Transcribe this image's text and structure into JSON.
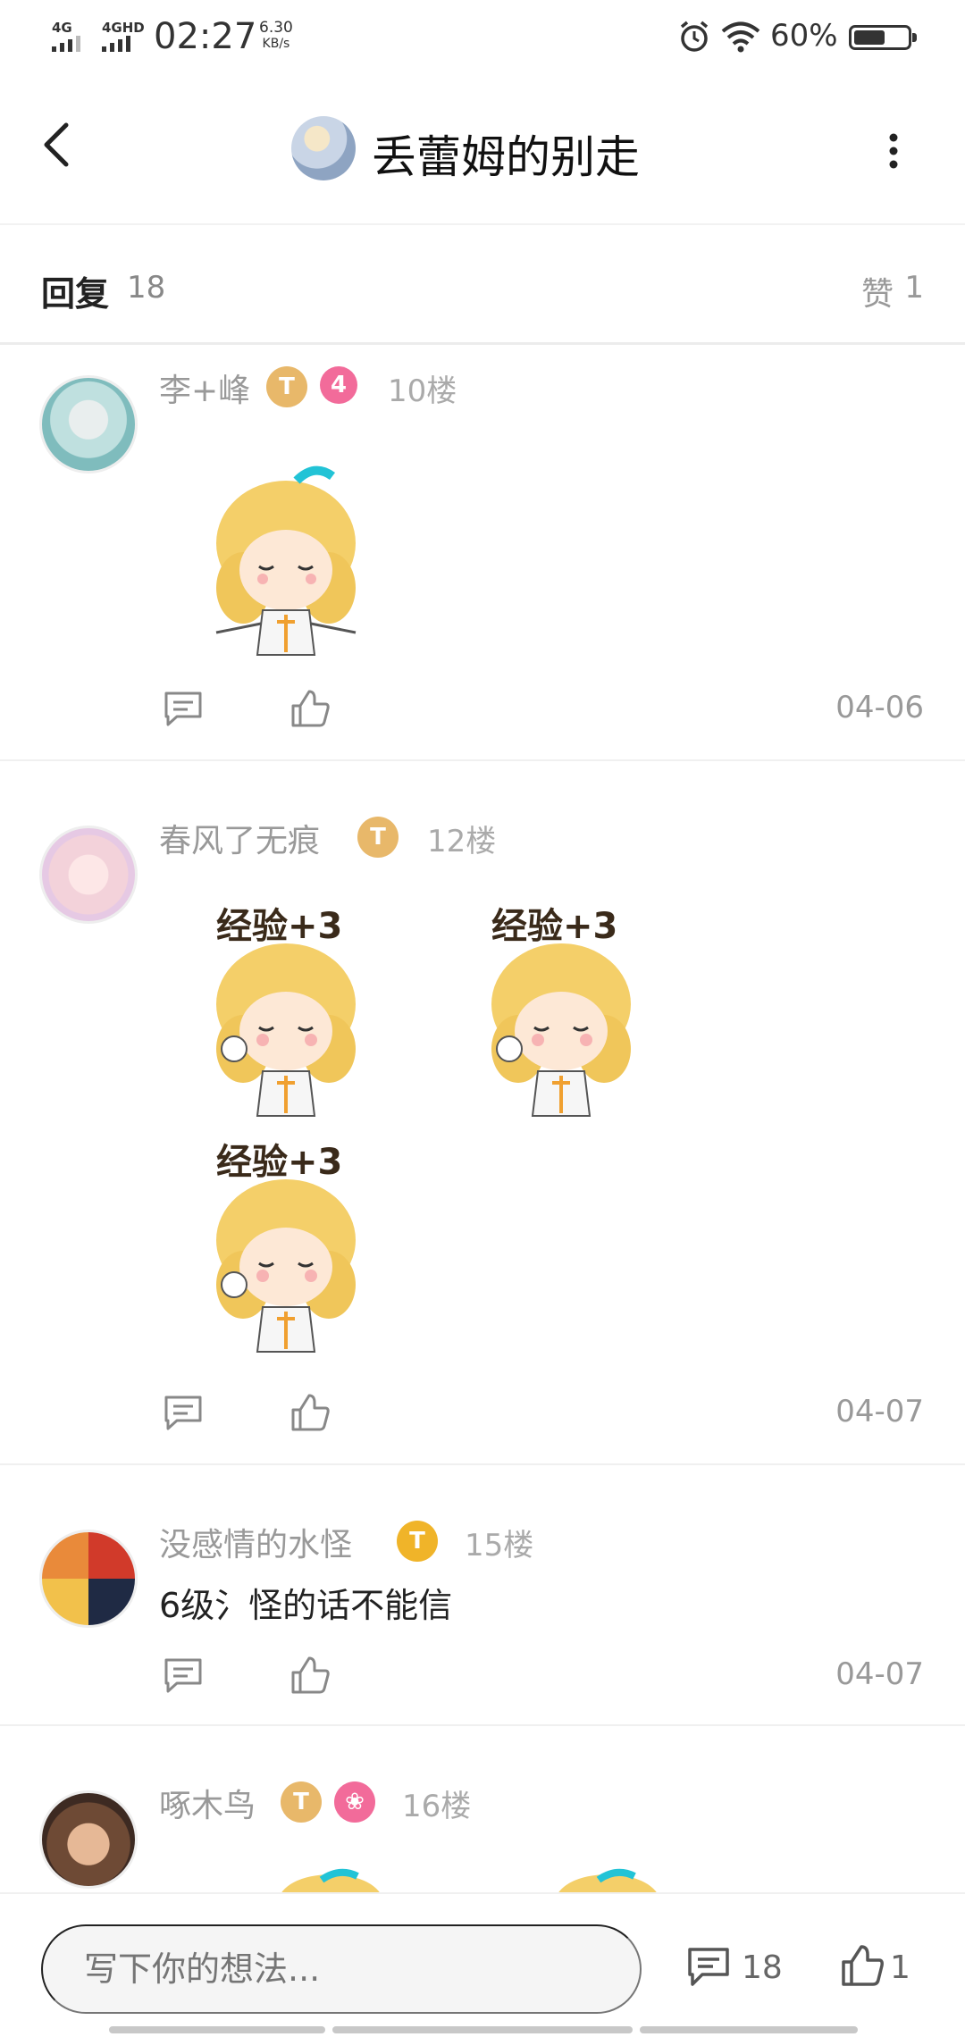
{
  "status_bar": {
    "net1": "4G",
    "net2": "4GHD",
    "time": "02:27",
    "speed_value": "6.30",
    "speed_unit": "KB/s",
    "battery": "60%",
    "battery_level": 0.6,
    "icons": [
      "alarm-icon",
      "wifi-icon",
      "battery-icon"
    ]
  },
  "header": {
    "title": "丢蕾姆的别走"
  },
  "replies_bar": {
    "reply_label": "回复",
    "reply_count": "18",
    "like_label": "赞",
    "like_count": "1"
  },
  "posts": [
    {
      "username": "李+峰",
      "badges": [
        {
          "text": "T",
          "color": "#e8b86a"
        },
        {
          "text": "4",
          "color": "#f26b9a"
        }
      ],
      "floor": "10楼",
      "text": "",
      "stickers": [
        "sticker-girl"
      ],
      "date": "04-06"
    },
    {
      "username": "春风了无痕",
      "badges": [
        {
          "text": "T",
          "color": "#e8b86a"
        }
      ],
      "floor": "12楼",
      "text": "",
      "stickers": [
        "sticker-exp",
        "sticker-exp",
        "sticker-exp"
      ],
      "sticker_caption": "经验+3",
      "date": "04-07"
    },
    {
      "username": "没感情的水怪",
      "badges": [
        {
          "text": "T",
          "color": "#f0b429"
        }
      ],
      "floor": "15楼",
      "text": "6级氵怪的话不能信",
      "stickers": [],
      "date": "04-07"
    },
    {
      "username": "啄木鸟",
      "badges": [
        {
          "text": "T",
          "color": "#e8b86a"
        },
        {
          "text": "",
          "color": "#f26b9a"
        }
      ],
      "floor": "16楼",
      "text": "",
      "stickers": [
        "sticker-girl",
        "sticker-girl"
      ],
      "date": ""
    }
  ],
  "bottom_bar": {
    "input_placeholder": "写下你的想法...",
    "comment_count": "18",
    "like_count": "1"
  },
  "colors": {
    "text_primary": "#222222",
    "text_secondary": "#999999",
    "badge_gold": "#e8b86a",
    "badge_pink": "#f26b9a",
    "sticker_cyan": "#22c3d6"
  }
}
